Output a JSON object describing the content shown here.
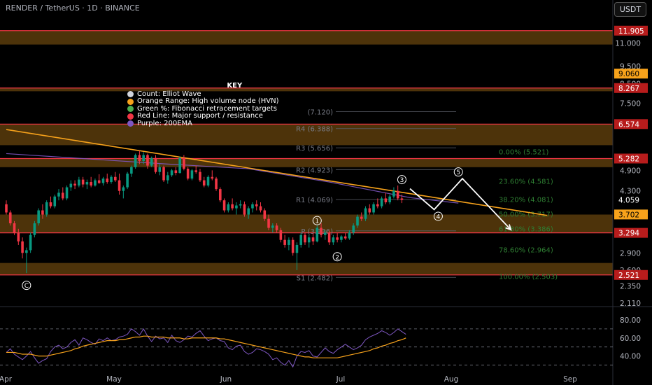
{
  "header": {
    "symbol_line": "RENDER / TetherUS · 1D · BINANCE",
    "currency_button": "USDT"
  },
  "legend": {
    "title": "KEY",
    "items": [
      {
        "label": "Count: Elliot Wave",
        "color": "#d1d4dc"
      },
      {
        "label": "Orange Range: High volume node (HVN)",
        "color": "#f7a21b"
      },
      {
        "label": "Green %: Fibonacci retracement targets",
        "color": "#4caf50"
      },
      {
        "label": "Red Line: Major support / resistance",
        "color": "#f23645"
      },
      {
        "label": "Purple: 200EMA",
        "color": "#7e57c2"
      }
    ]
  },
  "colors": {
    "up": "#26a69a",
    "up_body": "#089981",
    "down": "#f23645",
    "hvn": "#f7a21b",
    "support": "#f23645",
    "ema": "#7e57c2",
    "fib_text": "#2e7d32",
    "pivot_text": "#787b86",
    "rsi": "#7e57c2",
    "rsi_ma": "#f7a21b",
    "trend": "#f7a21b",
    "projection": "#ffffff"
  },
  "chart_data": {
    "type": "candlestick",
    "price_axis": {
      "scale": "log",
      "ticks": [
        11.0,
        9.5,
        8.5,
        7.5,
        4.9,
        4.3,
        3.3,
        2.9,
        2.6,
        2.35,
        2.11
      ],
      "ylim": [
        2.08,
        13.0
      ]
    },
    "time_axis": {
      "labels": [
        "Apr",
        "May",
        "Jun",
        "Jul",
        "Aug",
        "Sep"
      ]
    },
    "price_tags": [
      {
        "value": "11.905",
        "kind": "support"
      },
      {
        "value": "9.060",
        "kind": "highlight"
      },
      {
        "value": "8.267",
        "kind": "support"
      },
      {
        "value": "6.574",
        "kind": "support"
      },
      {
        "value": "5.282",
        "kind": "support"
      },
      {
        "value": "4.059",
        "kind": "last"
      },
      {
        "value": "3.702",
        "kind": "highlight"
      },
      {
        "value": "3.294",
        "kind": "support"
      },
      {
        "value": "2.521",
        "kind": "support"
      }
    ],
    "support_lines": [
      11.905,
      8.267,
      6.574,
      5.282,
      3.294,
      2.521
    ],
    "hvn_zones": [
      [
        10.9,
        11.905
      ],
      [
        8.1,
        8.267
      ],
      [
        5.75,
        6.574
      ],
      [
        5.0,
        5.282
      ],
      [
        3.294,
        3.7
      ],
      [
        2.521,
        2.72
      ]
    ],
    "pivots": [
      {
        "label": "R4 (6.388)",
        "value": 6.388
      },
      {
        "label": "R3 (5.656)",
        "value": 5.656
      },
      {
        "label": "R2 (4.923)",
        "value": 4.923
      },
      {
        "label": "R1 (4.069)",
        "value": 4.069
      },
      {
        "label": "P (3.336)",
        "value": 3.336
      },
      {
        "label": "S1 (2.482)",
        "value": 2.482
      },
      {
        "label": "(7.120)",
        "value": 7.12
      }
    ],
    "fib_levels": [
      {
        "label": "0.00% (5.521)",
        "value": 5.521
      },
      {
        "label": "23.60% (4.581)",
        "value": 4.581
      },
      {
        "label": "38.20% (4.081)",
        "value": 4.081
      },
      {
        "label": "50.00% (3.717)",
        "value": 3.717
      },
      {
        "label": "61.80% (3.386)",
        "value": 3.386
      },
      {
        "label": "78.60% (2.964)",
        "value": 2.964
      },
      {
        "label": "100.00% (2.503)",
        "value": 2.503
      }
    ],
    "wave_labels": [
      {
        "label": "C",
        "day": 5,
        "value": 2.36
      },
      {
        "label": "1",
        "day": 77,
        "value": 3.56
      },
      {
        "label": "2",
        "day": 82,
        "value": 2.83
      },
      {
        "label": "3",
        "day": 98,
        "value": 4.62
      }
    ],
    "projection": {
      "points": [
        [
          100,
          4.36
        ],
        [
          106,
          3.82
        ],
        [
          113,
          4.65
        ],
        [
          125,
          3.36
        ]
      ],
      "labels": [
        {
          "label": "4",
          "day": 107,
          "value": 3.66
        },
        {
          "label": "5",
          "day": 112,
          "value": 4.85
        }
      ]
    },
    "trendline": [
      [
        0,
        6.35
      ],
      [
        134,
        3.68
      ]
    ],
    "ema200": [
      [
        0,
        5.45
      ],
      [
        40,
        5.1
      ],
      [
        60,
        4.95
      ],
      [
        80,
        4.55
      ],
      [
        100,
        4.12
      ],
      [
        112,
        3.98
      ]
    ],
    "rsi": {
      "ticks": [
        80.0,
        60.0,
        40.0
      ],
      "ylim": [
        25,
        90
      ],
      "upper": 70,
      "lower": 30,
      "series": [
        44,
        48,
        42,
        39,
        36,
        40,
        45,
        38,
        32,
        35,
        37,
        45,
        50,
        52,
        48,
        50,
        55,
        58,
        52,
        60,
        58,
        55,
        53,
        59,
        57,
        60,
        57,
        58,
        61,
        62,
        64,
        70,
        67,
        63,
        70,
        62,
        56,
        62,
        59,
        60,
        55,
        63,
        57,
        55,
        58,
        62,
        61,
        65,
        68,
        62,
        57,
        59,
        60,
        57,
        56,
        49,
        47,
        51,
        52,
        45,
        42,
        44,
        48,
        47,
        45,
        42,
        36,
        38,
        33,
        30,
        35,
        28,
        40,
        45,
        44,
        46,
        40,
        39,
        44,
        49,
        45,
        43,
        47,
        50,
        53,
        50,
        47,
        49,
        52,
        58,
        61,
        63,
        65,
        68,
        66,
        63,
        66,
        70,
        67,
        64
      ],
      "ma": [
        44,
        44,
        44,
        43,
        42,
        42,
        42,
        41,
        40,
        40,
        40,
        41,
        42,
        43,
        44,
        45,
        46,
        48,
        49,
        51,
        52,
        53,
        54,
        55,
        56,
        57,
        57,
        57,
        58,
        58,
        59,
        60,
        61,
        61,
        62,
        62,
        61,
        61,
        61,
        61,
        60,
        60,
        60,
        60,
        59,
        59,
        60,
        60,
        60,
        60,
        60,
        60,
        60,
        59,
        59,
        58,
        57,
        56,
        55,
        54,
        53,
        52,
        51,
        50,
        49,
        48,
        47,
        46,
        45,
        44,
        43,
        42,
        41,
        40,
        39,
        39,
        38,
        38,
        38,
        38,
        38,
        38,
        38,
        39,
        40,
        41,
        42,
        43,
        44,
        45,
        46,
        48,
        49,
        51,
        52,
        54,
        55,
        57,
        58,
        60
      ]
    },
    "candles": [
      [
        3.95,
        4.05,
        3.7,
        3.75
      ],
      [
        3.75,
        3.8,
        3.45,
        3.5
      ],
      [
        3.5,
        3.55,
        3.25,
        3.3
      ],
      [
        3.3,
        3.38,
        3.05,
        3.12
      ],
      [
        3.12,
        3.2,
        2.8,
        2.9
      ],
      [
        2.9,
        3.0,
        2.55,
        2.95
      ],
      [
        2.95,
        3.3,
        2.9,
        3.25
      ],
      [
        3.25,
        3.55,
        3.2,
        3.5
      ],
      [
        3.5,
        3.85,
        3.45,
        3.8
      ],
      [
        3.8,
        3.95,
        3.6,
        3.7
      ],
      [
        3.7,
        4.05,
        3.65,
        4.0
      ],
      [
        4.0,
        4.15,
        3.85,
        3.9
      ],
      [
        3.9,
        4.2,
        3.85,
        4.15
      ],
      [
        4.15,
        4.35,
        4.05,
        4.25
      ],
      [
        4.25,
        4.4,
        4.05,
        4.1
      ],
      [
        4.1,
        4.45,
        4.05,
        4.4
      ],
      [
        4.4,
        4.6,
        4.3,
        4.5
      ],
      [
        4.5,
        4.6,
        4.35,
        4.45
      ],
      [
        4.45,
        4.7,
        4.4,
        4.62
      ],
      [
        4.62,
        4.7,
        4.4,
        4.48
      ],
      [
        4.48,
        4.62,
        4.35,
        4.55
      ],
      [
        4.55,
        4.7,
        4.4,
        4.45
      ],
      [
        4.45,
        4.65,
        4.42,
        4.6
      ],
      [
        4.6,
        4.78,
        4.5,
        4.52
      ],
      [
        4.52,
        4.7,
        4.45,
        4.65
      ],
      [
        4.65,
        4.8,
        4.5,
        4.55
      ],
      [
        4.55,
        4.75,
        4.5,
        4.7
      ],
      [
        4.7,
        4.85,
        4.55,
        4.6
      ],
      [
        4.6,
        4.8,
        4.2,
        4.3
      ],
      [
        4.3,
        4.45,
        4.1,
        4.4
      ],
      [
        4.4,
        4.85,
        4.35,
        4.8
      ],
      [
        4.8,
        5.05,
        4.7,
        5.0
      ],
      [
        5.0,
        5.45,
        4.95,
        5.4
      ],
      [
        5.4,
        5.55,
        5.1,
        5.2
      ],
      [
        5.2,
        5.5,
        5.1,
        5.4
      ],
      [
        5.4,
        5.45,
        4.95,
        5.05
      ],
      [
        5.05,
        5.35,
        5.0,
        5.3
      ],
      [
        5.3,
        5.4,
        4.8,
        4.85
      ],
      [
        4.85,
        5.1,
        4.75,
        5.0
      ],
      [
        5.0,
        5.05,
        4.55,
        4.6
      ],
      [
        4.6,
        4.85,
        4.5,
        4.75
      ],
      [
        4.75,
        4.95,
        4.7,
        4.9
      ],
      [
        4.9,
        5.0,
        4.75,
        4.82
      ],
      [
        4.82,
        5.35,
        4.8,
        5.3
      ],
      [
        5.3,
        5.4,
        4.9,
        4.95
      ],
      [
        4.95,
        5.0,
        4.6,
        4.65
      ],
      [
        4.65,
        4.95,
        4.6,
        4.9
      ],
      [
        4.9,
        5.05,
        4.8,
        4.85
      ],
      [
        4.85,
        4.95,
        4.55,
        4.6
      ],
      [
        4.6,
        4.7,
        4.4,
        4.45
      ],
      [
        4.45,
        4.75,
        4.4,
        4.7
      ],
      [
        4.7,
        4.9,
        4.6,
        4.65
      ],
      [
        4.65,
        4.7,
        4.3,
        4.35
      ],
      [
        4.35,
        4.4,
        4.0,
        4.05
      ],
      [
        4.05,
        4.1,
        3.75,
        3.8
      ],
      [
        3.8,
        4.0,
        3.75,
        3.95
      ],
      [
        3.95,
        4.1,
        3.8,
        3.85
      ],
      [
        3.85,
        4.0,
        3.7,
        3.92
      ],
      [
        3.92,
        4.05,
        3.85,
        3.95
      ],
      [
        3.95,
        4.02,
        3.65,
        3.7
      ],
      [
        3.7,
        3.9,
        3.6,
        3.85
      ],
      [
        3.85,
        4.0,
        3.75,
        3.95
      ],
      [
        3.95,
        4.05,
        3.8,
        3.9
      ],
      [
        3.9,
        4.0,
        3.75,
        3.8
      ],
      [
        3.8,
        3.85,
        3.55,
        3.6
      ],
      [
        3.6,
        3.7,
        3.35,
        3.4
      ],
      [
        3.4,
        3.5,
        3.3,
        3.45
      ],
      [
        3.45,
        3.5,
        3.3,
        3.35
      ],
      [
        3.35,
        3.4,
        3.1,
        3.15
      ],
      [
        3.15,
        3.25,
        3.0,
        3.05
      ],
      [
        3.05,
        3.2,
        2.95,
        3.15
      ],
      [
        3.15,
        3.2,
        2.85,
        2.9
      ],
      [
        2.9,
        3.1,
        2.6,
        3.05
      ],
      [
        3.05,
        3.3,
        3.0,
        3.25
      ],
      [
        3.25,
        3.3,
        3.05,
        3.1
      ],
      [
        3.1,
        3.25,
        3.0,
        3.2
      ],
      [
        3.2,
        3.3,
        3.05,
        3.12
      ],
      [
        3.12,
        3.45,
        3.1,
        3.4
      ],
      [
        3.4,
        3.5,
        3.2,
        3.25
      ],
      [
        3.25,
        3.35,
        3.15,
        3.3
      ],
      [
        3.3,
        3.35,
        3.05,
        3.1
      ],
      [
        3.1,
        3.25,
        3.05,
        3.2
      ],
      [
        3.2,
        3.3,
        3.1,
        3.15
      ],
      [
        3.15,
        3.25,
        3.1,
        3.22
      ],
      [
        3.22,
        3.3,
        3.15,
        3.18
      ],
      [
        3.18,
        3.35,
        3.15,
        3.3
      ],
      [
        3.3,
        3.5,
        3.25,
        3.45
      ],
      [
        3.45,
        3.7,
        3.4,
        3.65
      ],
      [
        3.65,
        3.75,
        3.55,
        3.6
      ],
      [
        3.6,
        3.9,
        3.55,
        3.85
      ],
      [
        3.85,
        3.95,
        3.7,
        3.75
      ],
      [
        3.75,
        4.0,
        3.7,
        3.95
      ],
      [
        3.95,
        4.1,
        3.85,
        3.9
      ],
      [
        3.9,
        4.15,
        3.85,
        4.1
      ],
      [
        4.1,
        4.25,
        3.95,
        4.0
      ],
      [
        4.0,
        4.2,
        3.95,
        4.15
      ],
      [
        4.15,
        4.4,
        4.1,
        4.3
      ],
      [
        4.3,
        4.45,
        4.05,
        4.1
      ],
      [
        4.1,
        4.2,
        3.98,
        4.06
      ]
    ]
  }
}
